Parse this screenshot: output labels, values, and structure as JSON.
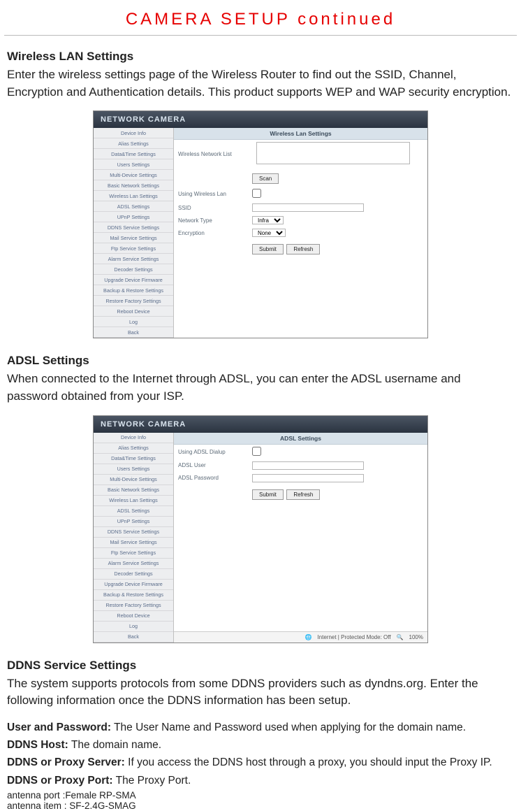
{
  "pageTitle": "CAMERA SETUP continued",
  "wireless": {
    "heading": "Wireless LAN Settings",
    "body": "Enter the wireless settings page of the Wireless Router to find out the SSID, Channel, Encryption and Authentication details. This product supports WEP and WAP security encryption."
  },
  "adsl": {
    "heading": "ADSL Settings",
    "body": "When connected to the Internet through ADSL,  you can enter the ADSL username and password obtained from your ISP."
  },
  "ddns": {
    "heading": "DDNS Service Settings",
    "body": "The system supports protocols from some DDNS providers such as dyndns.org. Enter the following information once the DDNS information has been setup."
  },
  "defs": {
    "userPass": {
      "term": "User and Password:",
      "text": " The User Name and Password used when applying for the domain name."
    },
    "host": {
      "term": "DDNS Host:",
      "text": " The domain name."
    },
    "proxySrv": {
      "term": "DDNS or Proxy Server:",
      "text": " If you access the DDNS host through a proxy, you should input the Proxy IP."
    },
    "proxyPort": {
      "term": "DDNS or Proxy Port:",
      "text": " The Proxy Port."
    }
  },
  "antenna": {
    "port": "antenna port :Female RP-SMA",
    "item": "antenna item : SF-2.4G-SMAG"
  },
  "ui": {
    "appTitle": "NETWORK CAMERA",
    "sidebar": [
      "Device Info",
      "Alias Settings",
      "Data&Time Settings",
      "Users Settings",
      "Multi-Device Settings",
      "Basic Network Settings",
      "Wireless Lan Settings",
      "ADSL Settings",
      "UPnP Settings",
      "DDNS Service Settings",
      "Mail Service Settings",
      "Ftp Service Settings",
      "Alarm Service Settings",
      "Decoder Settings",
      "Upgrade Device Firmware",
      "Backup & Restore Settings",
      "Restore Factory Settings",
      "Reboot Device",
      "Log",
      "Back"
    ],
    "wlan": {
      "panelTitle": "Wireless Lan Settings",
      "listLabel": "Wireless Network List",
      "scan": "Scan",
      "usingWlan": "Using Wireless Lan",
      "ssid": "SSID",
      "netType": "Network Type",
      "netTypeVal": "Infra",
      "encryption": "Encryption",
      "encryptionVal": "None",
      "submit": "Submit",
      "refresh": "Refresh"
    },
    "adsl": {
      "panelTitle": "ADSL Settings",
      "usingAdsl": "Using ADSL Dialup",
      "user": "ADSL User",
      "pass": "ADSL Password",
      "submit": "Submit",
      "refresh": "Refresh"
    },
    "statusbar": {
      "mode": "Internet | Protected Mode: Off",
      "zoom": "100%"
    }
  }
}
